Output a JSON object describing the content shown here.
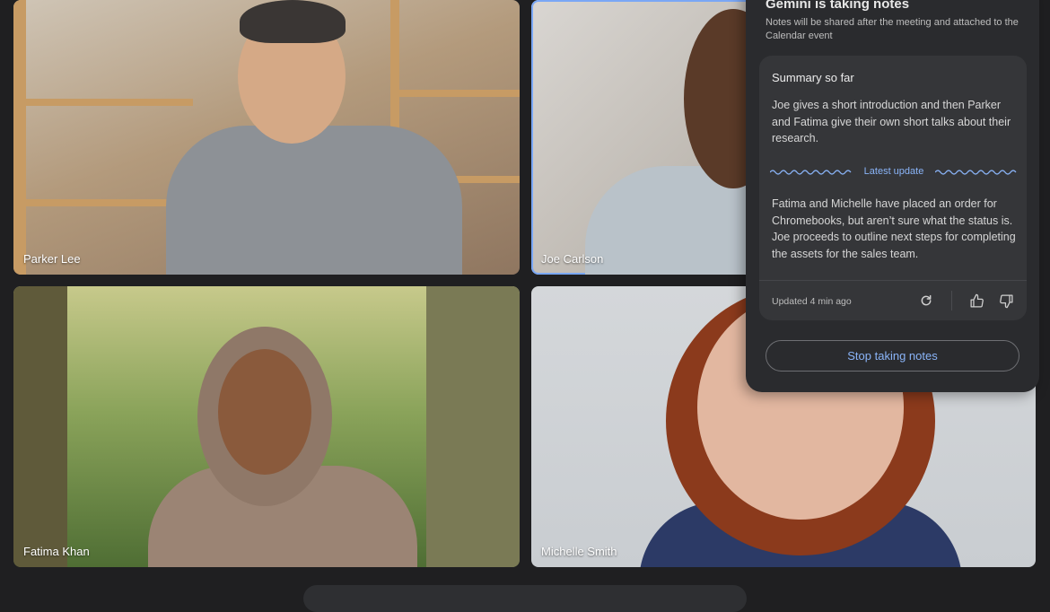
{
  "participants": [
    {
      "name": "Parker Lee"
    },
    {
      "name": "Joe Carlson"
    },
    {
      "name": "Fatima Khan"
    },
    {
      "name": "Michelle Smith"
    }
  ],
  "gemini": {
    "title": "Gemini is taking notes",
    "subtitle": "Notes will be shared after the meeting and attached to the Calendar event",
    "summary": {
      "heading": "Summary so far",
      "text1": "Joe gives a short introduction and then Parker and Fatima give their own short talks about their research.",
      "latest_label": "Latest update",
      "text2": "Fatima and Michelle have placed an order for Chromebooks, but aren’t sure what the status is. Joe proceeds to outline next steps for completing the assets for the sales team.",
      "updated": "Updated 4 min ago"
    },
    "stop_button": "Stop taking notes"
  },
  "colors": {
    "background": "#1f1f21",
    "panel": "#2a2b2e",
    "card": "#353639",
    "accent": "#8ab4f8",
    "active_speaker_border": "#7aa7f5"
  },
  "icons": [
    "refresh-icon",
    "thumbs-up-icon",
    "thumbs-down-icon"
  ]
}
